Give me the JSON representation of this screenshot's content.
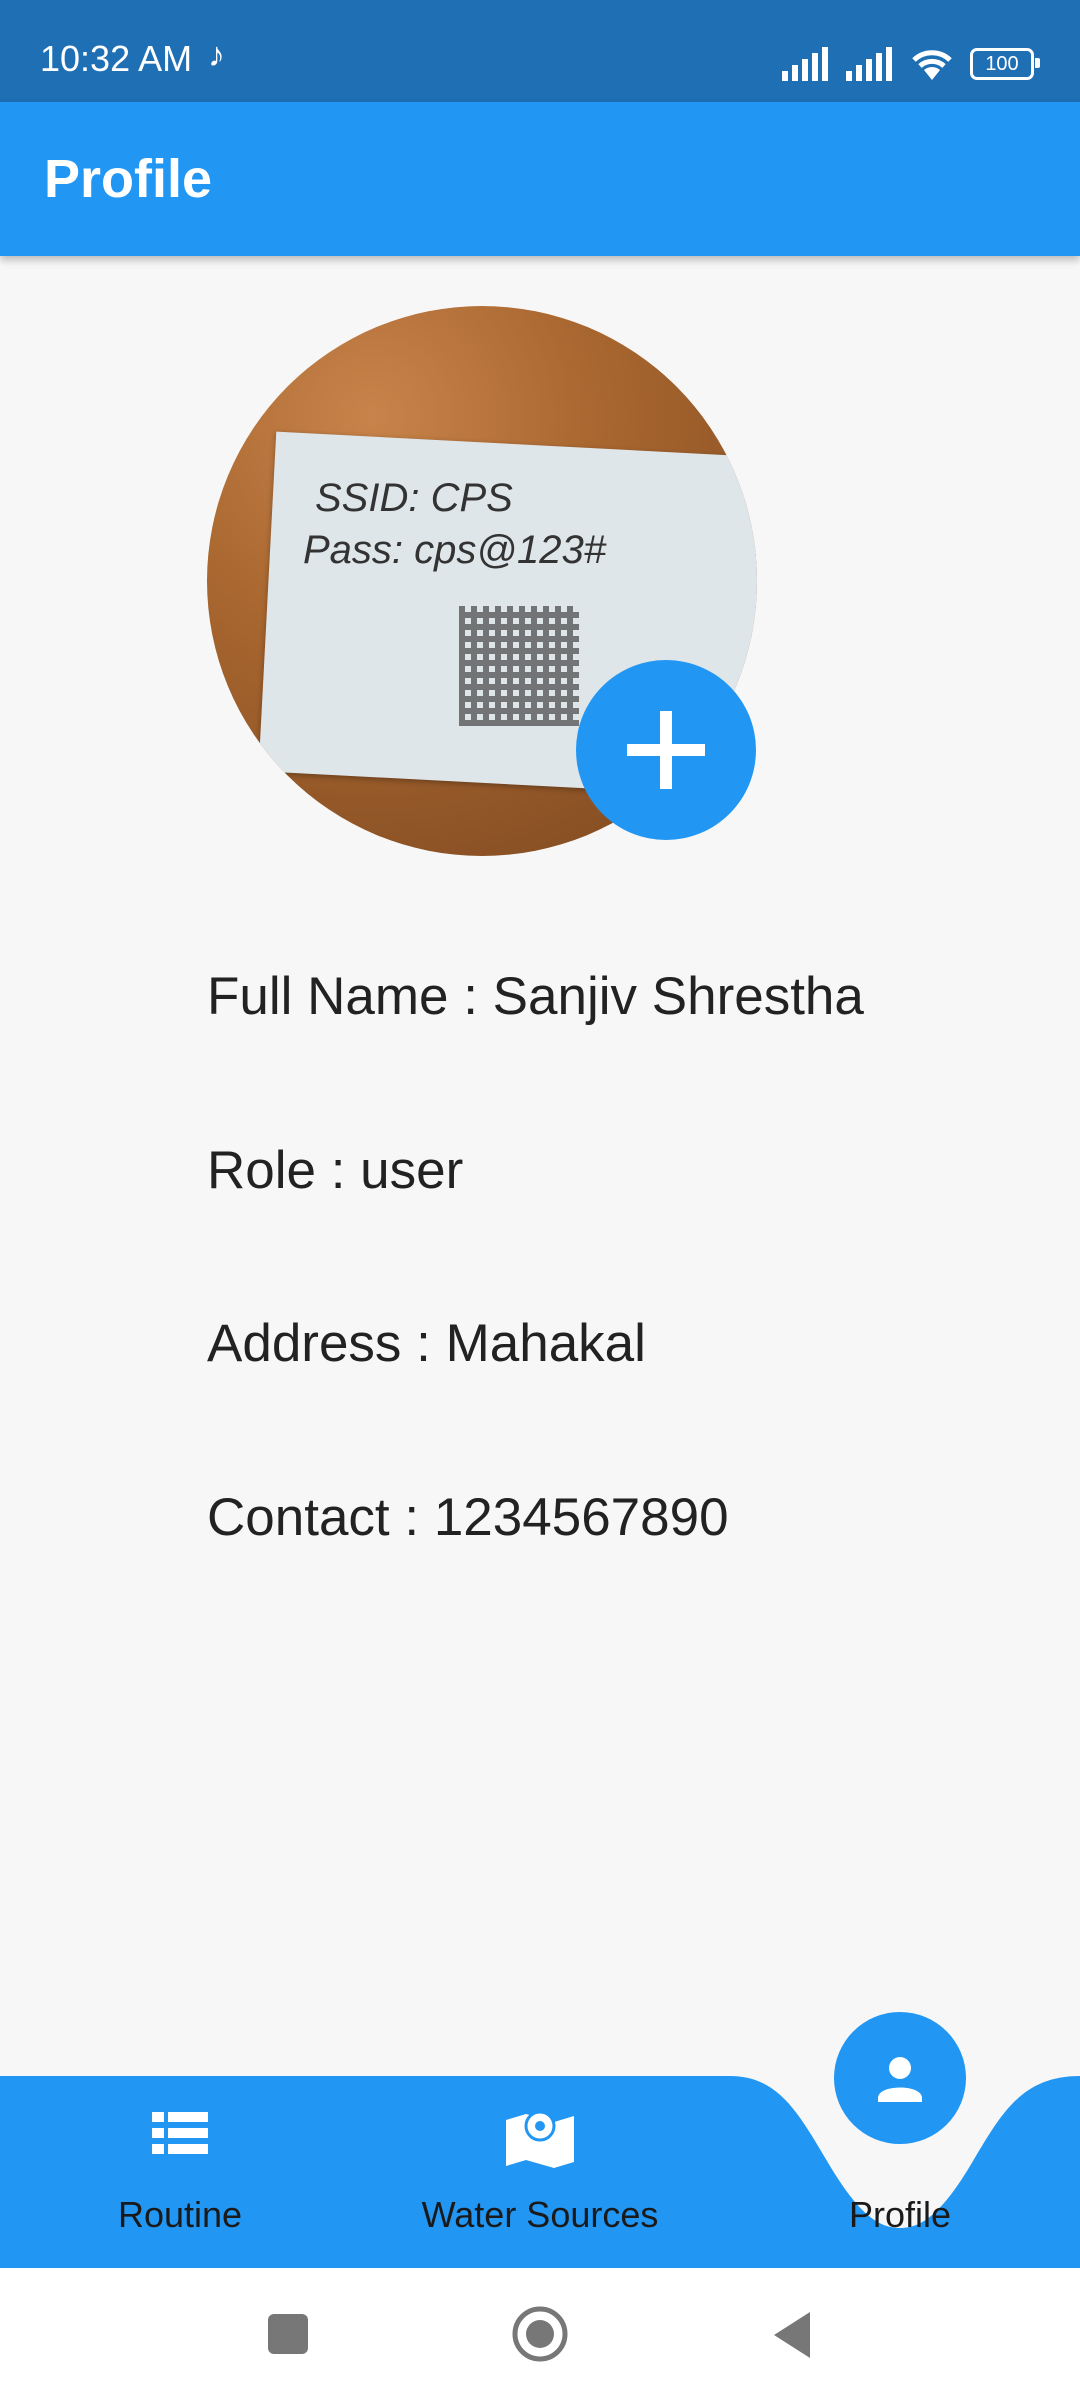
{
  "status_bar": {
    "time": "10:32 AM",
    "battery": "100"
  },
  "app_bar": {
    "title": "Profile"
  },
  "profile_photo": {
    "paper_line1": "SSID: CPS",
    "paper_line2": "Pass: cps@123#"
  },
  "details": [
    "Full Name : Sanjiv Shrestha",
    "Role : user",
    "Address : Mahakal",
    "Contact : 1234567890"
  ],
  "bottom_nav": {
    "items": [
      {
        "label": "Routine",
        "icon": "list-icon"
      },
      {
        "label": "Water Sources",
        "icon": "map-icon"
      },
      {
        "label": "Profile",
        "icon": "person-icon"
      }
    ],
    "selected": "Profile"
  },
  "colors": {
    "primary": "#2196f3",
    "status_bar": "#1f6fb5",
    "background": "#f7f7f7"
  }
}
